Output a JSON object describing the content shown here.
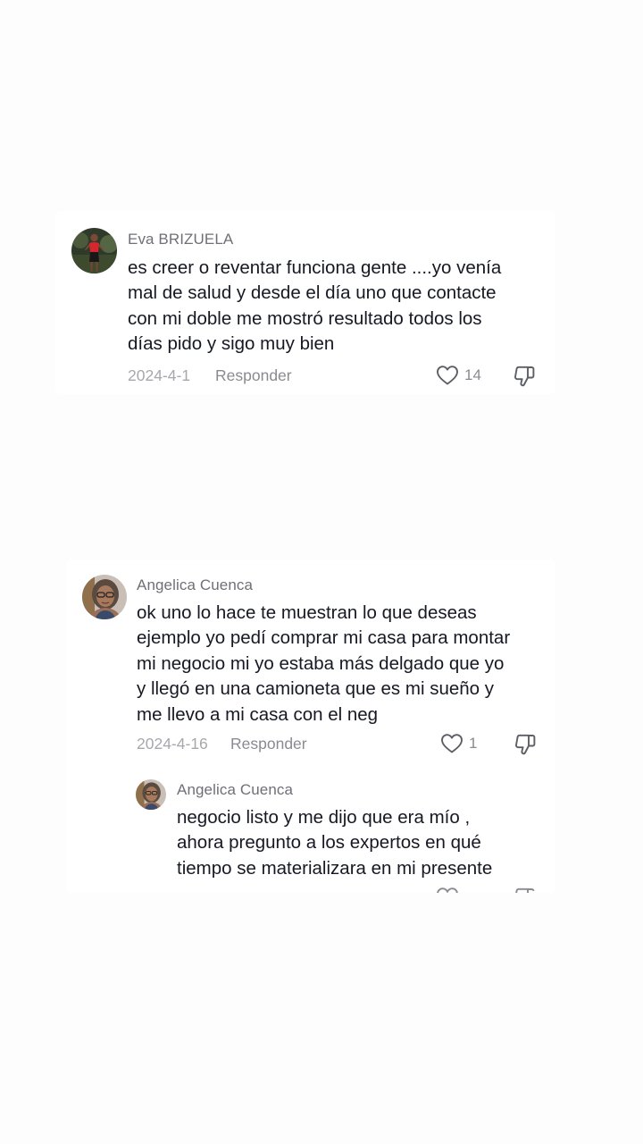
{
  "comments": [
    {
      "username": "Eva BRIZUELA",
      "text": "es creer o reventar funciona gente ....yo venía\nmal de salud y desde el día uno que contacte\ncon mi doble me mostró resultado todos los\ndías pido y sigo muy bien",
      "date": "2024-4-1",
      "reply_label": "Responder",
      "likes": "14",
      "avatar_icon": "profile-photo-woman-red-top"
    },
    {
      "username": "Angelica Cuenca",
      "text": "ok uno lo hace te muestran lo que deseas\nejemplo yo pedí comprar mi casa para montar\nmi negocio mi yo estaba más delgado que yo\ny llegó en una camioneta que es mi sueño y\nme llevo a mi casa con el neg",
      "date": "2024-4-16",
      "reply_label": "Responder",
      "likes": "1",
      "avatar_icon": "profile-photo-woman-glasses",
      "reply": {
        "username": "Angelica Cuenca",
        "text": "negocio listo y me dijo que era mío ,\nahora pregunto a los expertos en qué\ntiempo se materializara en mi presente"
      }
    }
  ],
  "icons": {
    "like": "heart-outline-icon",
    "dislike": "thumbs-down-outline-icon"
  },
  "colors": {
    "background": "#fdfdfd",
    "card": "#ffffff",
    "text": "#161823",
    "secondary_text": "#8a8b91"
  }
}
